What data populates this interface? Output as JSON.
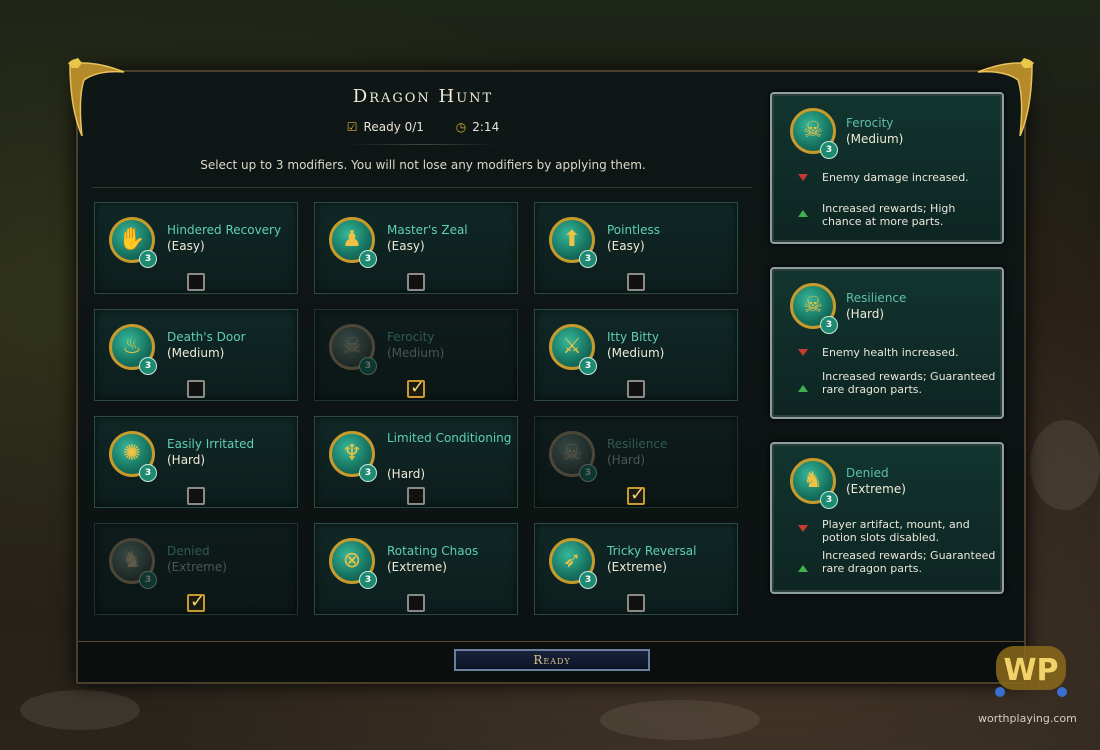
{
  "title": "Dragon Hunt",
  "status": {
    "ready": "Ready 0/1",
    "timer": "2:14"
  },
  "instruction": "Select up to 3 modifiers. You will not lose any modifiers by applying them.",
  "modifiers": [
    {
      "name": "Hindered Recovery",
      "difficulty": "(Easy)",
      "badge": "3",
      "icon": "flame-hand-icon",
      "selected": false,
      "dim": false
    },
    {
      "name": "Master's Zeal",
      "difficulty": "(Easy)",
      "badge": "3",
      "icon": "three-figures-icon",
      "selected": false,
      "dim": false
    },
    {
      "name": "Pointless",
      "difficulty": "(Easy)",
      "badge": "3",
      "icon": "broken-arrow-icon",
      "selected": false,
      "dim": false
    },
    {
      "name": "Death's Door",
      "difficulty": "(Medium)",
      "badge": "3",
      "icon": "burning-figure-icon",
      "selected": false,
      "dim": false
    },
    {
      "name": "Ferocity",
      "difficulty": "(Medium)",
      "badge": "3",
      "icon": "skull-icon",
      "selected": true,
      "dim": true
    },
    {
      "name": "Itty Bitty",
      "difficulty": "(Medium)",
      "badge": "3",
      "icon": "broken-sword-icon",
      "selected": false,
      "dim": false
    },
    {
      "name": "Easily Irritated",
      "difficulty": "(Hard)",
      "badge": "3",
      "icon": "beast-head-icon",
      "selected": false,
      "dim": false
    },
    {
      "name": "Limited Conditioning",
      "difficulty": "(Hard)",
      "badge": "3",
      "icon": "trident-icon",
      "selected": false,
      "dim": false
    },
    {
      "name": "Resilience",
      "difficulty": "(Hard)",
      "badge": "3",
      "icon": "armored-skull-icon",
      "selected": true,
      "dim": true
    },
    {
      "name": "Denied",
      "difficulty": "(Extreme)",
      "badge": "3",
      "icon": "mount-icon",
      "selected": true,
      "dim": true
    },
    {
      "name": "Rotating Chaos",
      "difficulty": "(Extreme)",
      "badge": "3",
      "icon": "crossed-circles-icon",
      "selected": false,
      "dim": false
    },
    {
      "name": "Tricky Reversal",
      "difficulty": "(Extreme)",
      "badge": "3",
      "icon": "archer-icon",
      "selected": false,
      "dim": false
    }
  ],
  "selected_panels": [
    {
      "name": "Ferocity",
      "difficulty": "(Medium)",
      "badge": "3",
      "icon": "skull-icon",
      "down_effect": "Enemy damage increased.",
      "up_effect": "Increased rewards; High chance at more parts."
    },
    {
      "name": "Resilience",
      "difficulty": "(Hard)",
      "badge": "3",
      "icon": "armored-skull-icon",
      "down_effect": "Enemy health increased.",
      "up_effect": "Increased rewards; Guaranteed rare dragon parts."
    },
    {
      "name": "Denied",
      "difficulty": "(Extreme)",
      "badge": "3",
      "icon": "mount-icon",
      "down_effect": "Player artifact, mount, and potion slots disabled.",
      "up_effect": "Increased rewards; Guaranteed rare dragon parts."
    }
  ],
  "ready_button": "Ready",
  "watermark": "worthplaying.com",
  "colors": {
    "accent_teal": "#5fd0b1",
    "gold": "#c79a2c",
    "down_red": "#c63a31",
    "up_green": "#42b04c"
  }
}
